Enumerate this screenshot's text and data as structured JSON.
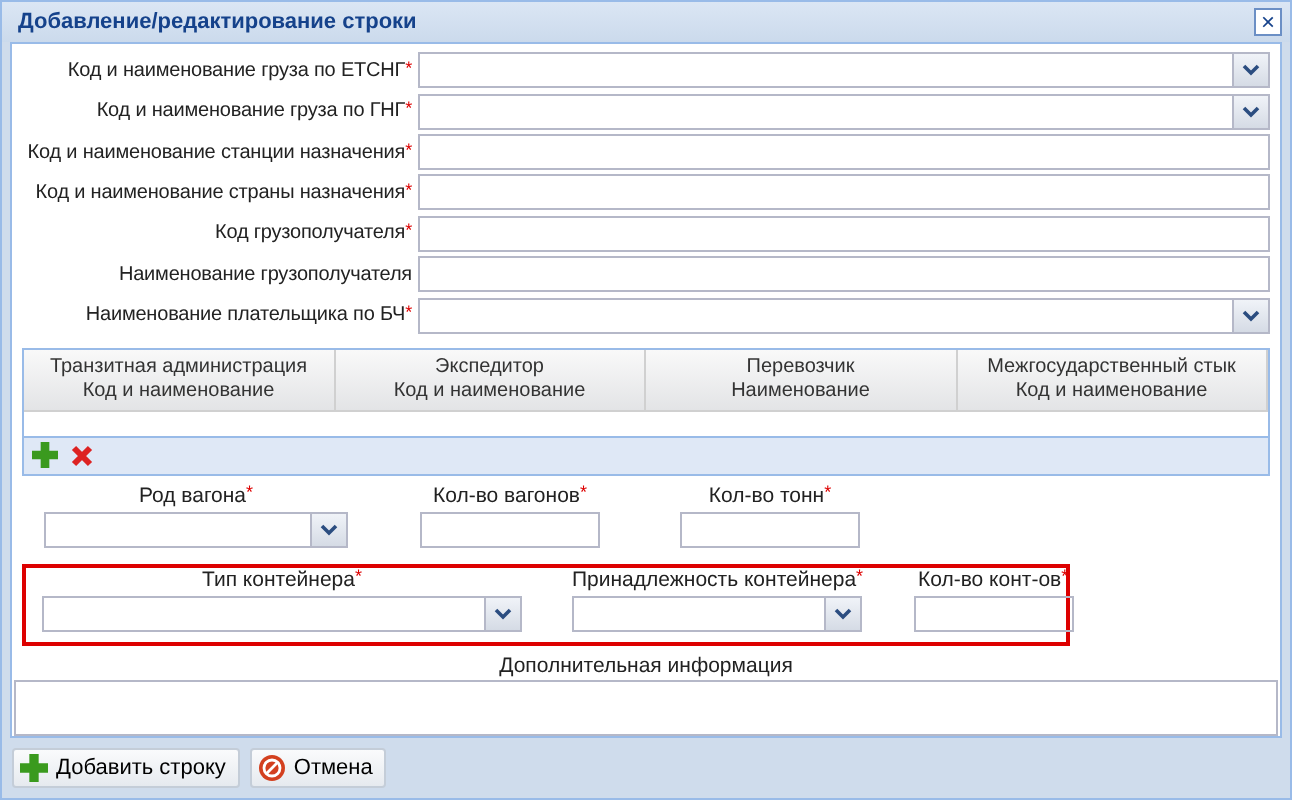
{
  "window": {
    "title": "Добавление/редактирование строки",
    "close": "×"
  },
  "fields": [
    {
      "label": "Код и наименование груза по ЕТСНГ$^{*}$",
      "kind": "combo"
    },
    {
      "label": "Код и наименование груза по ГНГ$^{*}$",
      "kind": "combo"
    },
    {
      "label": "Код и наименование станции назначения$^{*}$",
      "kind": "text"
    },
    {
      "label": "Код и наименование страны назначения$^{*}$",
      "kind": "text"
    },
    {
      "label": "Код грузополучателя$^{*}$",
      "kind": "text"
    },
    {
      "label": "Наименование грузополучателя",
      "kind": "text"
    },
    {
      "label": "Наименование плательщика по БЧ$^{*}$",
      "kind": "combo"
    }
  ],
  "table": {
    "columns": [
      [
        "Транзитная администрация",
        "Код и наименование"
      ],
      [
        "Экспедитор",
        "Код и наименование"
      ],
      [
        "Перевозчик",
        "Наименование"
      ],
      [
        "Межгосударственный стык",
        "Код и наименование"
      ]
    ]
  },
  "wagon_fields": [
    {
      "label": "Род вагона$^{*}$",
      "kind": "combo"
    },
    {
      "label": "Кол-во вагонов$^{*}$",
      "kind": "text"
    },
    {
      "label": "Кол-во тонн$^{*}$",
      "kind": "text"
    }
  ],
  "container_fields": [
    {
      "label": "Тип контейнера$^{*}$",
      "kind": "combo"
    },
    {
      "label": "Принадлежность контейнера$^{*}$",
      "kind": "combo"
    },
    {
      "label": "Кол-во конт-ов$^{*}$",
      "kind": "text"
    }
  ],
  "additional_info": {
    "label": "Дополнительная информация"
  },
  "buttons": [
    {
      "label": "Добавить строку",
      "kind": "add"
    },
    {
      "label": "Отмена",
      "kind": "cancel"
    }
  ]
}
